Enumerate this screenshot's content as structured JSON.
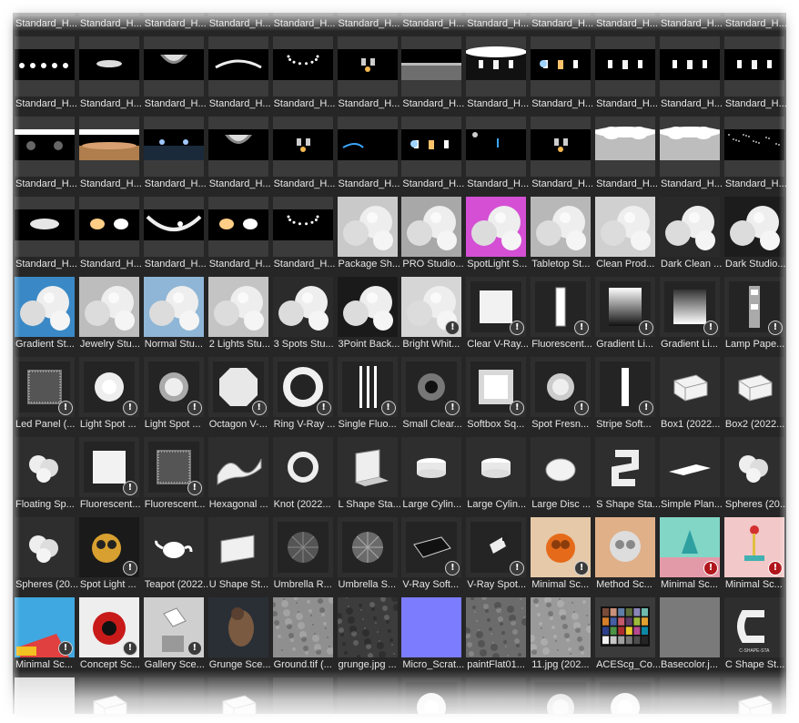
{
  "browser": {
    "warning_icon_symbol": "!",
    "colors": {
      "panel_bg": "#262626",
      "tile_bg": "#3b3b3b",
      "label_text": "#e6e6e6",
      "warning_badge_bg": "#3a3a3a",
      "warning_badge_fg": "#ffffff",
      "warning_red_bg": "#b0151c"
    },
    "rows": [
      {
        "row_name": "top-partial",
        "items": [
          {
            "label": "Standard_H...",
            "thumb": "hdri"
          },
          {
            "label": "Standard_H...",
            "thumb": "hdri"
          },
          {
            "label": "Standard_H...",
            "thumb": "hdri"
          },
          {
            "label": "Standard_H...",
            "thumb": "hdri"
          },
          {
            "label": "Standard_H...",
            "thumb": "hdri"
          },
          {
            "label": "Standard_H...",
            "thumb": "hdri"
          },
          {
            "label": "Standard_H...",
            "thumb": "hdri"
          },
          {
            "label": "Standard_H...",
            "thumb": "hdri"
          },
          {
            "label": "Standard_H...",
            "thumb": "hdri"
          },
          {
            "label": "Standard_H...",
            "thumb": "hdri"
          },
          {
            "label": "Standard_H...",
            "thumb": "hdri"
          },
          {
            "label": "Standard_H...",
            "thumb": "hdri"
          }
        ]
      },
      {
        "row_name": "hdri-1",
        "items": [
          {
            "label": "Standard_H...",
            "thumb": "hdri",
            "variant": "bulbs"
          },
          {
            "label": "Standard_H...",
            "thumb": "hdri",
            "variant": "spots"
          },
          {
            "label": "Standard_H...",
            "thumb": "hdri",
            "variant": "dome"
          },
          {
            "label": "Standard_H...",
            "thumb": "hdri",
            "variant": "strips"
          },
          {
            "label": "Standard_H...",
            "thumb": "hdri",
            "variant": "ring"
          },
          {
            "label": "Standard_H...",
            "thumb": "hdri",
            "variant": "lamps"
          },
          {
            "label": "Standard_H...",
            "thumb": "hdri",
            "variant": "horizon"
          },
          {
            "label": "Standard_H...",
            "thumb": "hdri",
            "variant": "bright"
          },
          {
            "label": "Standard_H...",
            "thumb": "hdri",
            "variant": "warm"
          },
          {
            "label": "Standard_H...",
            "thumb": "hdri",
            "variant": "panels"
          },
          {
            "label": "Standard_H...",
            "thumb": "hdri",
            "variant": "panels"
          },
          {
            "label": "Standard_H...",
            "thumb": "hdri",
            "variant": "panels"
          }
        ]
      },
      {
        "row_name": "hdri-2",
        "items": [
          {
            "label": "Standard_H...",
            "thumb": "hdri",
            "variant": "dots"
          },
          {
            "label": "Standard_H...",
            "thumb": "hdri",
            "variant": "warmfloor"
          },
          {
            "label": "Standard_H...",
            "thumb": "hdri",
            "variant": "bluefloor"
          },
          {
            "label": "Standard_H...",
            "thumb": "hdri",
            "variant": "dome"
          },
          {
            "label": "Standard_H...",
            "thumb": "hdri",
            "variant": "lamps"
          },
          {
            "label": "Standard_H...",
            "thumb": "hdri",
            "variant": "bluearc"
          },
          {
            "label": "Standard_H...",
            "thumb": "hdri",
            "variant": "warm"
          },
          {
            "label": "Standard_H...",
            "thumb": "hdri",
            "variant": "darkspots"
          },
          {
            "label": "Standard_H...",
            "thumb": "hdri",
            "variant": "lamps"
          },
          {
            "label": "Standard_H...",
            "thumb": "hdri",
            "variant": "white"
          },
          {
            "label": "Standard_H...",
            "thumb": "hdri",
            "variant": "white"
          },
          {
            "label": "Standard_H...",
            "thumb": "hdri",
            "variant": "stars"
          }
        ]
      },
      {
        "row_name": "studio-1",
        "items": [
          {
            "label": "Standard_H...",
            "thumb": "hdri",
            "variant": "glow"
          },
          {
            "label": "Standard_H...",
            "thumb": "hdri",
            "variant": "warmglow"
          },
          {
            "label": "Standard_H...",
            "thumb": "hdri",
            "variant": "arc"
          },
          {
            "label": "Standard_H...",
            "thumb": "hdri",
            "variant": "warmglow"
          },
          {
            "label": "Standard_H...",
            "thumb": "hdri",
            "variant": "ring"
          },
          {
            "label": "Package Sh...",
            "thumb": "spheres",
            "bg": "#c9c9c9"
          },
          {
            "label": "PRO Studio...",
            "thumb": "spheres",
            "bg": "#a8a8a8"
          },
          {
            "label": "SpotLight S...",
            "thumb": "spheres",
            "bg": "#d44fd4"
          },
          {
            "label": "Tabletop St...",
            "thumb": "spheres",
            "bg": "#b8b8b8"
          },
          {
            "label": "Clean Prod...",
            "thumb": "spheres",
            "bg": "#d0d0d0"
          },
          {
            "label": "Dark Clean ...",
            "thumb": "spheres",
            "bg": "#2a2a2a"
          },
          {
            "label": "Dark Studio...",
            "thumb": "spheres",
            "bg": "#1c1c1c"
          }
        ]
      },
      {
        "row_name": "studio-2",
        "items": [
          {
            "label": "Gradient St...",
            "thumb": "spheres",
            "bg": "#3a89c6"
          },
          {
            "label": "Jewelry Stu...",
            "thumb": "spheres",
            "bg": "#bdbdbd"
          },
          {
            "label": "Normal Stu...",
            "thumb": "spheres",
            "bg": "#8fb6d6"
          },
          {
            "label": "2 Lights Stu...",
            "thumb": "spheres",
            "bg": "#c4c4c4"
          },
          {
            "label": "3 Spots Stu...",
            "thumb": "spheres",
            "bg": "#2b2b2b"
          },
          {
            "label": "3Point Back...",
            "thumb": "spheres",
            "bg": "#1a1a1a"
          },
          {
            "label": "Bright Whit...",
            "thumb": "spheres",
            "bg": "#d6d6d6",
            "warn": "grey"
          },
          {
            "label": "Clear V-Ray...",
            "thumb": "panel",
            "variant": "square",
            "warn": "grey"
          },
          {
            "label": "Fluorescent...",
            "thumb": "panel",
            "variant": "tube",
            "warn": "grey"
          },
          {
            "label": "Gradient Li...",
            "thumb": "panel",
            "variant": "gradient",
            "warn": "grey"
          },
          {
            "label": "Gradient Li...",
            "thumb": "panel",
            "variant": "gradient2",
            "warn": "grey"
          },
          {
            "label": "Lamp Pape...",
            "thumb": "panel",
            "variant": "lamp",
            "warn": "grey"
          }
        ]
      },
      {
        "row_name": "lights-1",
        "items": [
          {
            "label": "Led Panel (...",
            "thumb": "panel",
            "variant": "led",
            "warn": "grey"
          },
          {
            "label": "Light Spot ...",
            "thumb": "panel",
            "variant": "spot",
            "warn": "grey"
          },
          {
            "label": "Light Spot ...",
            "thumb": "panel",
            "variant": "spot2",
            "warn": "grey"
          },
          {
            "label": "Octagon V-...",
            "thumb": "panel",
            "variant": "octagon",
            "warn": "grey"
          },
          {
            "label": "Ring V-Ray ...",
            "thumb": "panel",
            "variant": "ring",
            "warn": "grey"
          },
          {
            "label": "Single Fluo...",
            "thumb": "panel",
            "variant": "fluo",
            "warn": "grey"
          },
          {
            "label": "Small Clear...",
            "thumb": "panel",
            "variant": "lens",
            "warn": "grey"
          },
          {
            "label": "Softbox Sq...",
            "thumb": "panel",
            "variant": "softbox",
            "warn": "grey"
          },
          {
            "label": "Spot Fresn...",
            "thumb": "panel",
            "variant": "fresnel",
            "warn": "grey"
          },
          {
            "label": "Stripe Soft...",
            "thumb": "panel",
            "variant": "stripe",
            "warn": "grey"
          },
          {
            "label": "Box1 (2022...",
            "thumb": "mesh",
            "variant": "box"
          },
          {
            "label": "Box2 (2022...",
            "thumb": "mesh",
            "variant": "box"
          }
        ]
      },
      {
        "row_name": "meshes-1",
        "items": [
          {
            "label": "Floating Sp...",
            "thumb": "mesh",
            "variant": "blob"
          },
          {
            "label": "Fluorescent...",
            "thumb": "panel",
            "variant": "square",
            "warn": "grey"
          },
          {
            "label": "Fluorescent...",
            "thumb": "panel",
            "variant": "led",
            "warn": "grey"
          },
          {
            "label": "Hexagonal ...",
            "thumb": "mesh",
            "variant": "wave"
          },
          {
            "label": "Knot (2022...",
            "thumb": "mesh",
            "variant": "knot"
          },
          {
            "label": "L Shape Sta...",
            "thumb": "mesh",
            "variant": "lshape"
          },
          {
            "label": "Large Cylin...",
            "thumb": "mesh",
            "variant": "cyl"
          },
          {
            "label": "Large Cylin...",
            "thumb": "mesh",
            "variant": "cyl"
          },
          {
            "label": "Large Disc ...",
            "thumb": "mesh",
            "variant": "disc"
          },
          {
            "label": "S Shape Sta...",
            "thumb": "mesh",
            "variant": "sshape"
          },
          {
            "label": "Simple Plan...",
            "thumb": "mesh",
            "variant": "plane"
          },
          {
            "label": "Spheres (20...",
            "thumb": "mesh",
            "variant": "blob"
          }
        ]
      },
      {
        "row_name": "scenes-1",
        "items": [
          {
            "label": "Spheres (20...",
            "thumb": "mesh",
            "variant": "blob"
          },
          {
            "label": "Spot Light ...",
            "thumb": "render",
            "variant": "goldspot",
            "warn": "grey"
          },
          {
            "label": "Teapot (2022...",
            "thumb": "mesh",
            "variant": "teapot"
          },
          {
            "label": "U Shape St...",
            "thumb": "mesh",
            "variant": "ushape"
          },
          {
            "label": "Umbrella R...",
            "thumb": "panel",
            "variant": "umbrella"
          },
          {
            "label": "Umbrella S...",
            "thumb": "panel",
            "variant": "umbrella2"
          },
          {
            "label": "V-Ray Soft...",
            "thumb": "panel",
            "variant": "vsoft",
            "warn": "grey"
          },
          {
            "label": "V-Ray Spot...",
            "thumb": "panel",
            "variant": "vspot",
            "warn": "grey"
          },
          {
            "label": "Minimal Sc...",
            "thumb": "render",
            "variant": "orange",
            "warn": "grey"
          },
          {
            "label": "Method Sc...",
            "thumb": "render",
            "variant": "method"
          },
          {
            "label": "Minimal Sc...",
            "thumb": "render",
            "variant": "teal",
            "warn": "red"
          },
          {
            "label": "Minimal Sc...",
            "thumb": "render",
            "variant": "pink",
            "warn": "red"
          }
        ]
      },
      {
        "row_name": "textures-1",
        "items": [
          {
            "label": "Minimal Sc...",
            "thumb": "render",
            "variant": "pop",
            "warn": "grey"
          },
          {
            "label": "Concept Sc...",
            "thumb": "render",
            "variant": "concept",
            "warn": "grey"
          },
          {
            "label": "Gallery Sce...",
            "thumb": "render",
            "variant": "gallery",
            "warn": "grey"
          },
          {
            "label": "Grunge Sce...",
            "thumb": "render",
            "variant": "grunge"
          },
          {
            "label": "Ground.tif (...",
            "thumb": "texture",
            "bg": "#8f8f8f"
          },
          {
            "label": "grunge.jpg ...",
            "thumb": "texture",
            "bg": "#3c3c3c"
          },
          {
            "label": "Micro_Scrat...",
            "thumb": "flat",
            "bg": "#7c7cff"
          },
          {
            "label": "paintFlat01...",
            "thumb": "texture",
            "bg": "#6b6b6b"
          },
          {
            "label": "11.jpg (202...",
            "thumb": "texture",
            "bg": "#9a9a9a"
          },
          {
            "label": "ACEScg_Co...",
            "thumb": "checker"
          },
          {
            "label": "Basecolor.j...",
            "thumb": "flat",
            "bg": "#7a7a7a"
          },
          {
            "label": "C Shape St...",
            "thumb": "mesh",
            "variant": "cshape",
            "caption": "C-SHAPE-STA"
          }
        ]
      },
      {
        "row_name": "bottom-partial",
        "items": [
          {
            "label": "",
            "thumb": "flat",
            "bg": "#d8d8d8"
          },
          {
            "label": "",
            "thumb": "mesh",
            "variant": "box"
          },
          {
            "label": "",
            "thumb": "flat",
            "bg": "#2f2f2f"
          },
          {
            "label": "",
            "thumb": "mesh",
            "variant": "box"
          },
          {
            "label": "",
            "thumb": "flat",
            "bg": "#3a3a3a"
          },
          {
            "label": "",
            "thumb": "flat",
            "bg": "#2f2f2f",
            "warn": "grey"
          },
          {
            "label": "",
            "thumb": "panel",
            "variant": "spot"
          },
          {
            "label": "",
            "thumb": "flat",
            "bg": "#2f2f2f"
          },
          {
            "label": "",
            "thumb": "panel",
            "variant": "fresnel"
          },
          {
            "label": "",
            "thumb": "panel",
            "variant": "spot"
          },
          {
            "label": "",
            "thumb": "flat",
            "bg": "#2f2f2f"
          },
          {
            "label": "",
            "thumb": "mesh",
            "variant": "box"
          }
        ]
      }
    ]
  }
}
